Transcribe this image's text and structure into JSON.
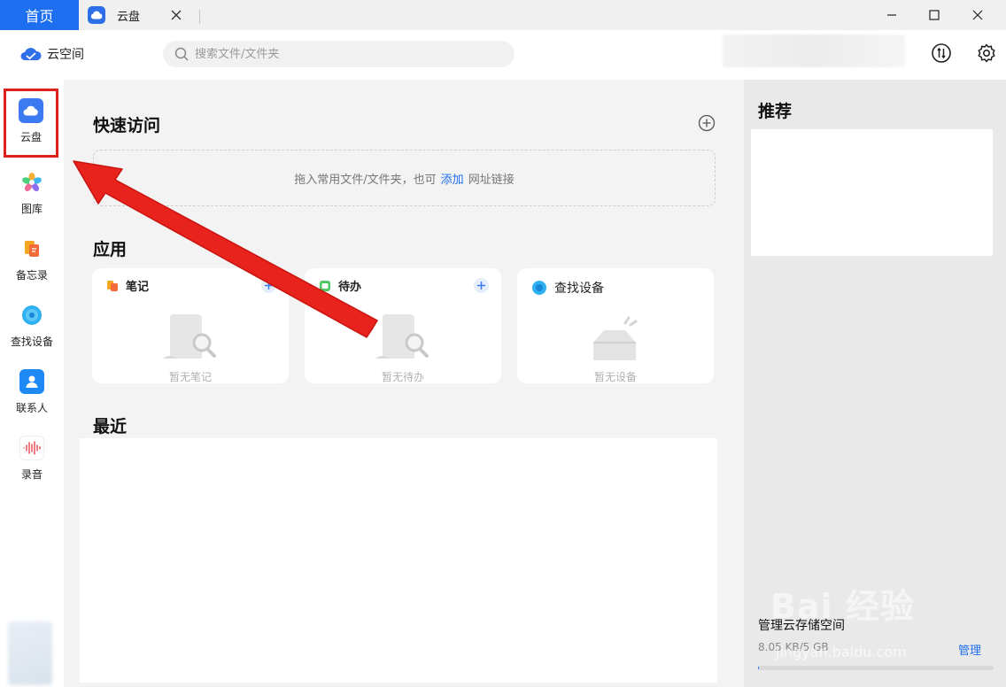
{
  "titlebar": {
    "home_tab": "首页",
    "cloud_tab": "云盘"
  },
  "header": {
    "logo_text": "云空间",
    "search_placeholder": "搜索文件/文件夹"
  },
  "sidebar": {
    "items": [
      {
        "label": "云盘",
        "icon": "cloud-drive-icon",
        "color": "#3b7af0"
      },
      {
        "label": "图库",
        "icon": "gallery-icon",
        "color": "#f1a23a"
      },
      {
        "label": "备忘录",
        "icon": "notes-icon",
        "color": "#f5a623"
      },
      {
        "label": "查找设备",
        "icon": "find-device-icon",
        "color": "#28a7f0"
      },
      {
        "label": "联系人",
        "icon": "contacts-icon",
        "color": "#1e88f5"
      },
      {
        "label": "录音",
        "icon": "recorder-icon",
        "color": "#e5484d"
      }
    ]
  },
  "main": {
    "quick_access_title": "快速访问",
    "dropzone_text_before": "拖入常用文件/文件夹，也可",
    "dropzone_link": "添加",
    "dropzone_text_after": "网址链接",
    "apps_title": "应用",
    "apps": [
      {
        "title": "笔记",
        "empty_text": "暂无笔记",
        "has_add": true
      },
      {
        "title": "待办",
        "empty_text": "暂无待办",
        "has_add": true
      },
      {
        "title": "查找设备",
        "empty_text": "暂无设备",
        "has_add": false
      }
    ],
    "recent_title": "最近"
  },
  "right_panel": {
    "title": "推荐",
    "storage_title": "管理云存储空间",
    "storage_usage": "8.05 KB/5 GB",
    "manage_label": "管理",
    "storage_fraction": 2e-06
  },
  "watermark": {
    "text": "Bai 经验",
    "url": "jingyan.baidu.com"
  },
  "colors": {
    "accent": "#1e6ff0",
    "annotation_red": "#e0201b"
  }
}
